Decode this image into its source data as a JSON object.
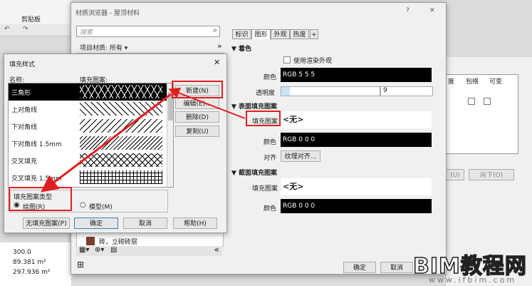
{
  "ribbon": {
    "panel_label": "剪贴板"
  },
  "material_browser": {
    "title": "材质浏览器 - 屋顶材料",
    "help": "?",
    "close": "✕",
    "search_placeholder": "搜索",
    "project_materials": "项目材质: 所有 ▾",
    "expand": "»",
    "list_item": "砖，立砌砖层",
    "collapse": "«",
    "tabs": [
      "标识",
      "图形",
      "外观",
      "热度",
      "+"
    ],
    "coloring": {
      "header": "▼ 着色",
      "use_render_label": "使用渲染外观",
      "color_label": "颜色",
      "color_value": "RGB 5 5 5",
      "transparency_label": "透明度",
      "transparency_value": "9"
    },
    "surface_pattern": {
      "header": "▼ 表面填充图案",
      "pattern_label": "填充图案",
      "pattern_value": "<无>",
      "color_label": "颜色",
      "color_value": "RGB 0 0 0",
      "align_label": "对齐",
      "align_button": "纹理对齐..."
    },
    "cut_pattern": {
      "header": "▼ 截面填充图案",
      "pattern_label": "填充图案",
      "pattern_value": "<无>",
      "color_label": "颜色",
      "color_value": "RGB 0 0 0"
    },
    "ok": "确定",
    "cancel": "取消"
  },
  "right_table": {
    "headers": [
      "度",
      "包络",
      "可变"
    ],
    "down_button": "向下(O)",
    "up_button_fragment": "(U)",
    "bottom_fragments": [
      "帮助(H)",
      "(R)"
    ]
  },
  "left_values": [
    "300.0",
    "89.381 m²",
    "297.936 m²"
  ],
  "fill_dialog": {
    "title": "填充样式",
    "close": "✕",
    "col_name": "名称:",
    "col_pattern": "填充图案:",
    "rows": [
      {
        "name": "三角形",
        "selected": true
      },
      {
        "name": "上对角线",
        "selected": false
      },
      {
        "name": "下对角线",
        "selected": false
      },
      {
        "name": "下对角线 1.5mm",
        "selected": false
      },
      {
        "name": "交叉填充",
        "selected": false
      },
      {
        "name": "交叉填充 1.5mm",
        "selected": false
      }
    ],
    "buttons": {
      "new": "新建(N)",
      "edit": "编辑(E)...",
      "delete": "删除(D)",
      "copy": "复制(U)"
    },
    "type_label": "填充图案类型",
    "type_drafting": "绘图(R)",
    "type_model": "模型(M)",
    "no_fill": "无填充图案(P)",
    "ok": "确定",
    "cancel": "取消",
    "help": "帮助(H)"
  },
  "watermark": {
    "brand": "BIM教程网",
    "url": "www.ifbim.com"
  },
  "colors": {
    "accent_red": "#e02020",
    "selection": "#000000",
    "window_bg": "#f0f0f0"
  }
}
